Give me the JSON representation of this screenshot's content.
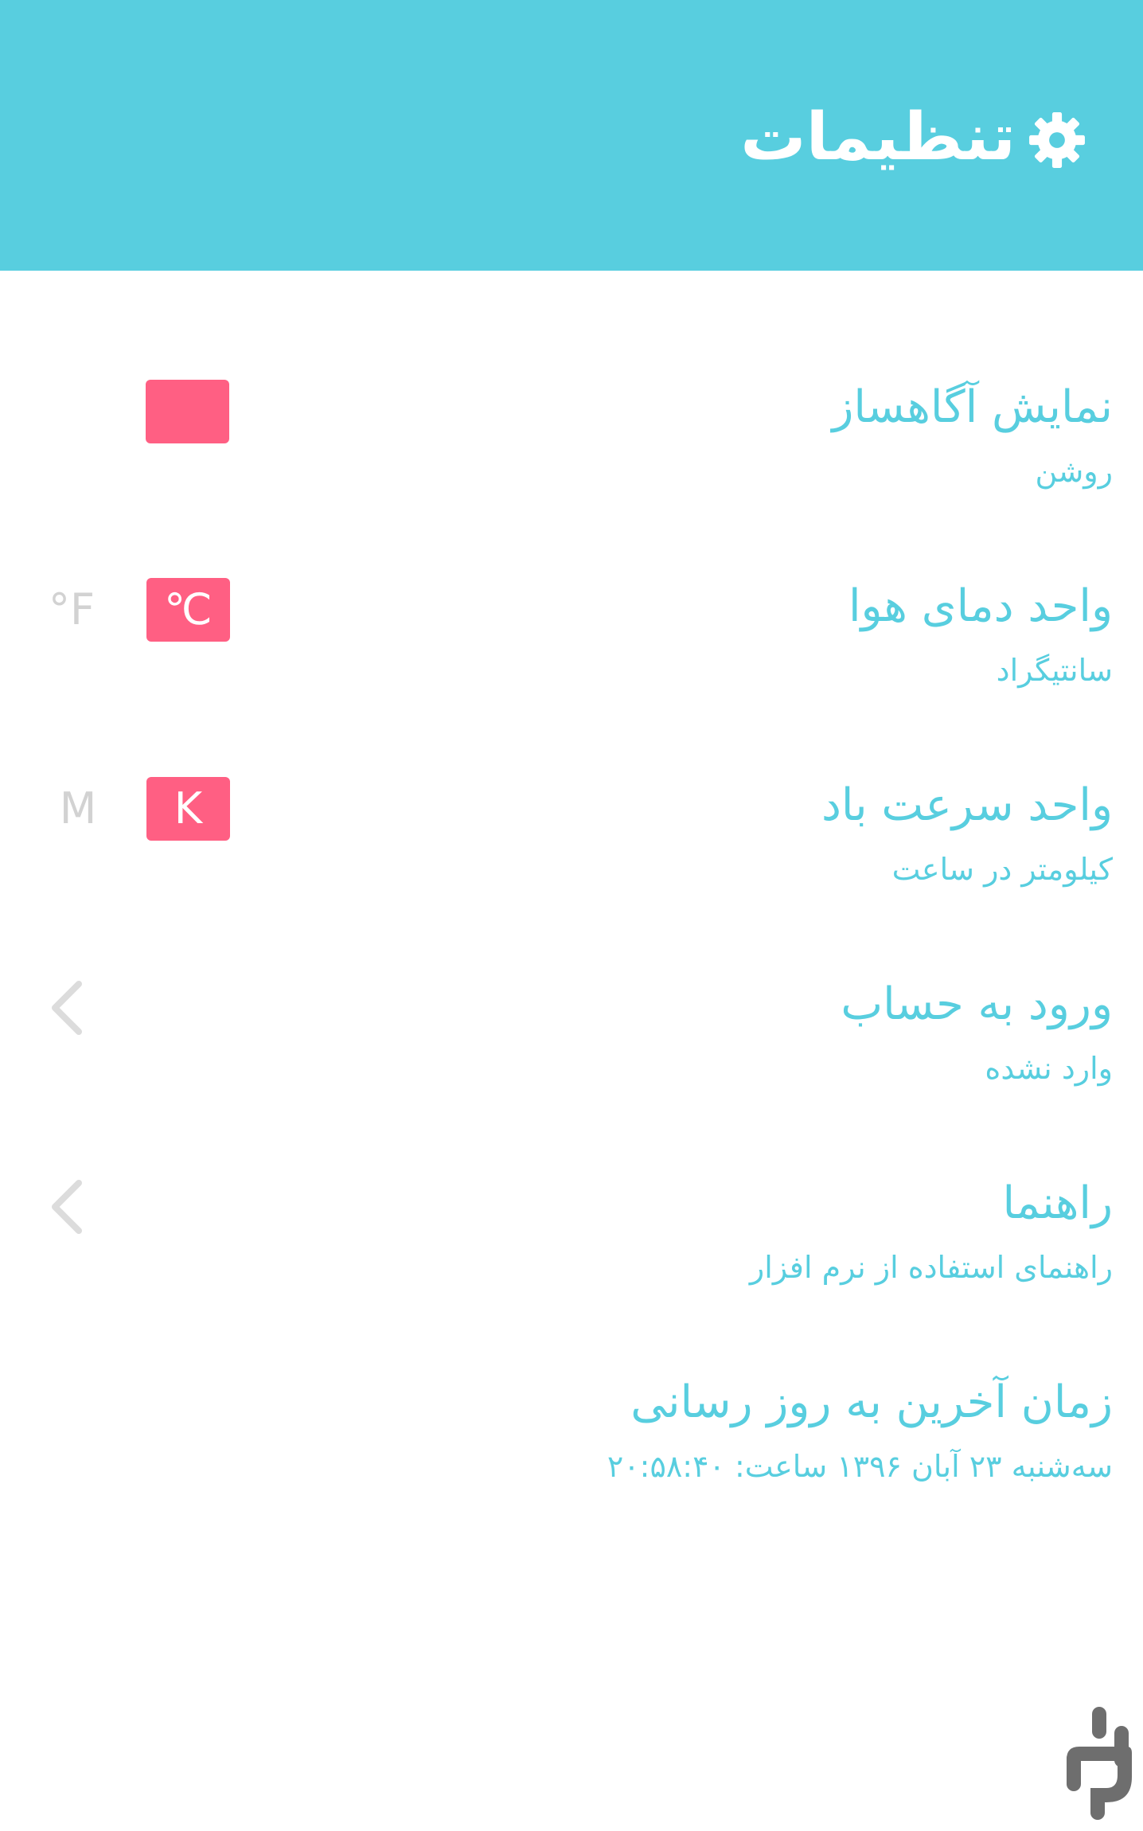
{
  "header": {
    "title": "تنظیمات",
    "icon": "gear-icon"
  },
  "settings": [
    {
      "title": "نمایش آگاهساز",
      "subtitle": "روشن"
    },
    {
      "title": "واحد دمای هوا",
      "subtitle": "سانتیگراد",
      "selected": "℃",
      "alternate": "°F"
    },
    {
      "title": "واحد سرعت باد",
      "subtitle": "کیلومتر در ساعت",
      "selected": "K",
      "alternate": "M"
    },
    {
      "title": "ورود به حساب",
      "subtitle": "وارد نشده"
    },
    {
      "title": "راهنما",
      "subtitle": "راهنمای استفاده از نرم افزار"
    },
    {
      "title": "زمان آخرین به روز رسانی",
      "subtitle": "سه‌شنبه ۲۳ آبان ۱۳۹۶ ساعت: ۲۰:۵۸:۴۰"
    }
  ],
  "colors": {
    "header_bg": "#58cedf",
    "accent_text": "#58cedf",
    "toggle_pink": "#ff5f83",
    "inactive": "#d2d2d2"
  }
}
